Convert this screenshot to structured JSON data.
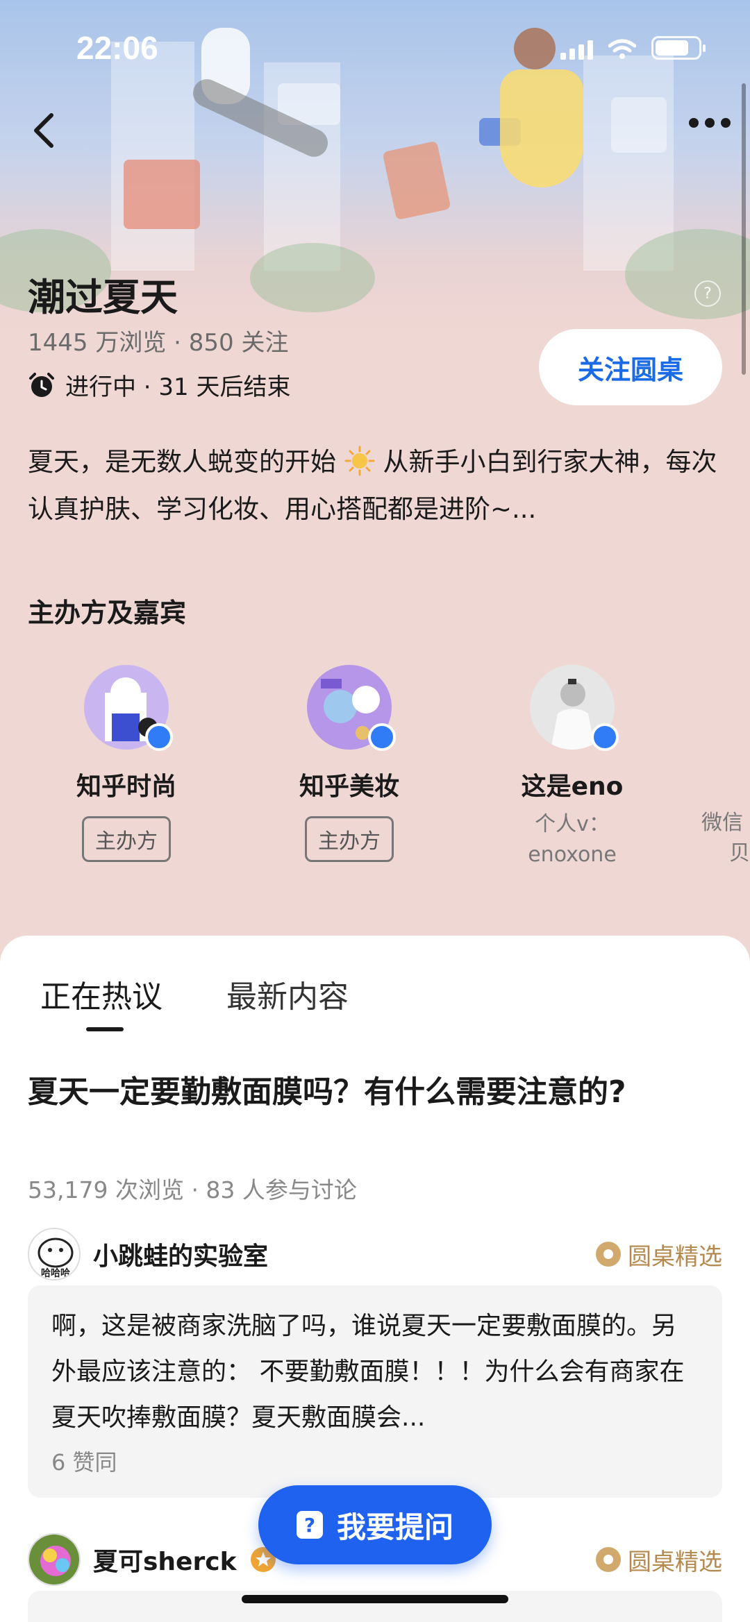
{
  "status_bar": {
    "time": "22:06"
  },
  "header": {
    "title": "潮过夏天",
    "stats": "1445 万浏览 · 850 关注",
    "progress": "进行中 · 31 天后结束",
    "follow_label": "关注圆桌",
    "help": "?"
  },
  "description": {
    "part1": "夏天，是无数人蜕变的开始",
    "part2": "从新手小白到行家大神，每次认真护肤、学习化妆、用心搭配都是进阶~..."
  },
  "hosts_section": {
    "title": "主办方及嘉宾",
    "hosts": [
      {
        "name": "知乎时尚",
        "tag": "主办方"
      },
      {
        "name": "知乎美妆",
        "tag": "主办方"
      },
      {
        "name": "这是eno",
        "sub1": "个人v：",
        "sub2": "enoxone"
      },
      {
        "sub1": "微信",
        "sub2": "贝"
      }
    ]
  },
  "tabs": [
    {
      "label": "正在热议"
    },
    {
      "label": "最新内容"
    }
  ],
  "question": {
    "title": "夏天一定要勤敷面膜吗？有什么需要注意的?",
    "stats": "53,179 次浏览 · 83 人参与讨论"
  },
  "answers": [
    {
      "user": "小跳蛙的实验室",
      "badge": "圆桌精选",
      "text": "啊，这是被商家洗脑了吗，谁说夏天一定要敷面膜的。另外最应该注意的： 不要勤敷面膜！！！为什么会有商家在夏天吹捧敷面膜？夏天敷面膜会...",
      "likes": "6 赞同",
      "avatar_text": "哈哈哈"
    },
    {
      "user": "夏可sherck",
      "badge": "圆桌精选"
    }
  ],
  "ask_button": {
    "label": "我要提问",
    "icon": "?"
  },
  "colors": {
    "accent": "#1f62f0",
    "background": "#efd7d3",
    "pick": "#b58a4e"
  }
}
